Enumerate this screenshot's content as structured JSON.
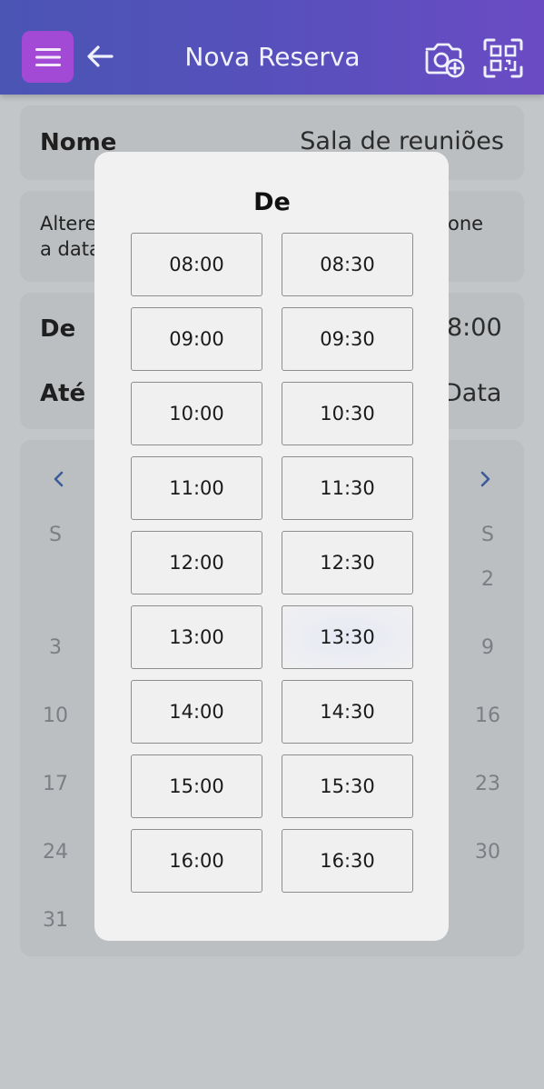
{
  "header": {
    "title": "Nova Reserva",
    "colors": {
      "start": "#4a55b4",
      "end": "#6b4bc4",
      "menu_button": "#a24ad6"
    },
    "icons": [
      "menu-icon",
      "back-arrow-icon",
      "camera-add-icon",
      "qr-scan-icon"
    ]
  },
  "form": {
    "name_label": "Nome",
    "name_value": "Sala de reuniões",
    "info_line1_left": "Altere",
    "info_line1_right": "one",
    "info_line2_left": "a data",
    "from_label": "De",
    "from_value": "8:00",
    "to_label": "Até",
    "to_value": "Data"
  },
  "calendar": {
    "weekday_left": "S",
    "weekday_right": "S",
    "left_column_days": [
      "3",
      "10",
      "17",
      "24",
      "31"
    ],
    "right_column_days": [
      "2",
      "9",
      "16",
      "23",
      "30"
    ]
  },
  "time_picker": {
    "title": "De",
    "slots": [
      "08:00",
      "08:30",
      "09:00",
      "09:30",
      "10:00",
      "10:30",
      "11:00",
      "11:30",
      "12:00",
      "12:30",
      "13:00",
      "13:30",
      "14:00",
      "14:30",
      "15:00",
      "15:30",
      "16:00",
      "16:30"
    ]
  }
}
